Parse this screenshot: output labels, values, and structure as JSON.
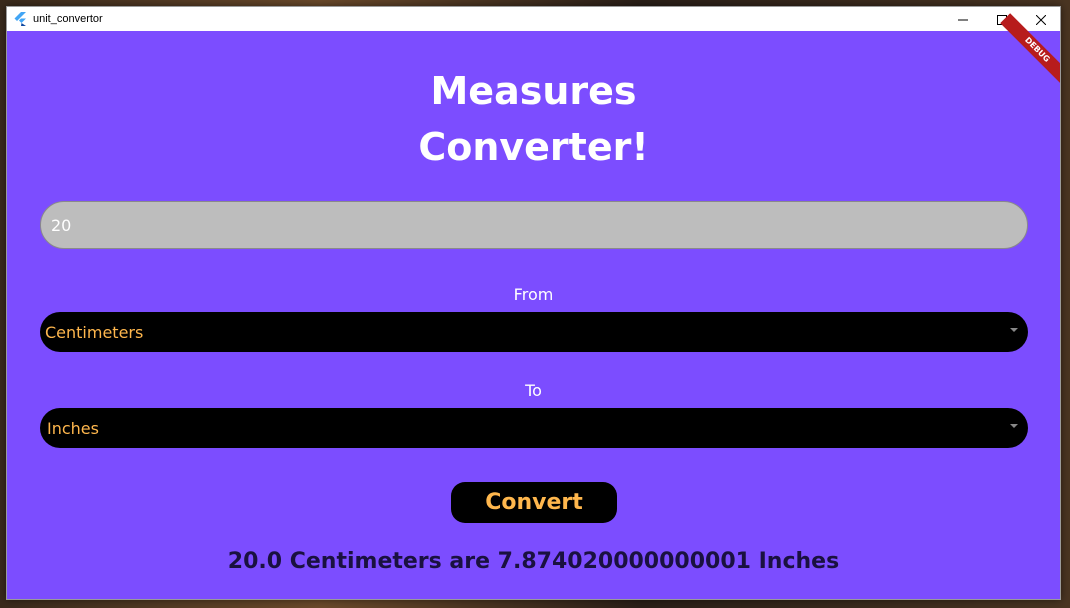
{
  "window": {
    "title": "unit_convertor",
    "app_icon": "flutter-icon",
    "controls": {
      "minimize_icon": "minimize-icon",
      "maximize_icon": "maximize-icon",
      "close_icon": "close-icon"
    }
  },
  "debug_banner": "DEBUG",
  "header": {
    "line1": "Measures",
    "line2": "Converter!"
  },
  "input": {
    "value": "20"
  },
  "from": {
    "label": "From",
    "selected": "Centimeters"
  },
  "to": {
    "label": "To",
    "selected": "Inches"
  },
  "convert_button": {
    "label": "Convert"
  },
  "result": {
    "text": "20.0 Centimeters are 7.874020000000001 Inches"
  },
  "colors": {
    "background": "#7c4dff",
    "accent_text": "#ffb74d",
    "input_bg": "#bdbdbd",
    "dropdown_bg": "#000000",
    "result_text": "#1a1140"
  }
}
